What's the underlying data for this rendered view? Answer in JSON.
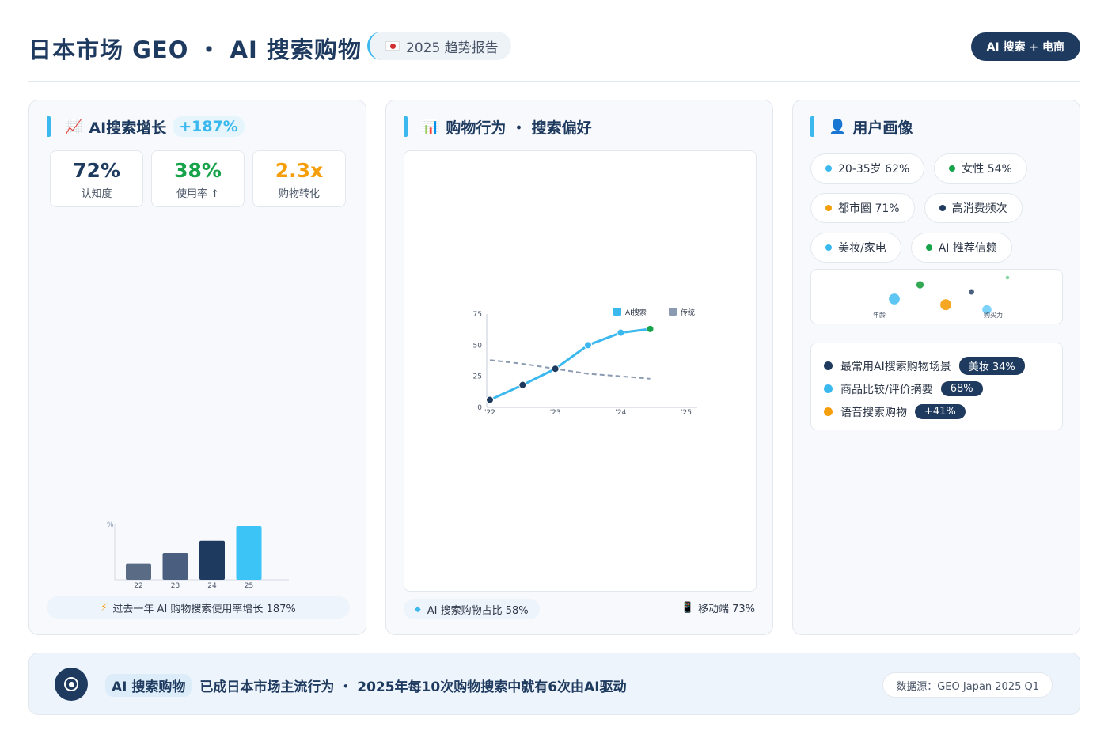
{
  "header": {
    "title": "日本市场 GEO ・ AI 搜索购物",
    "report_label": "2025 趋势报告",
    "badge": "AI 搜索 + 电商"
  },
  "panel_growth": {
    "title": "AI搜索增长",
    "icon": "chart-up-icon",
    "growth": "+187%",
    "kpis": [
      {
        "value": "72%",
        "label": "认知度",
        "color": "#1e3a5f"
      },
      {
        "value": "38%",
        "label": "使用率 ↑",
        "color": "#16a34a"
      },
      {
        "value": "2.3x",
        "label": "购物转化",
        "color": "#f59e0b"
      }
    ],
    "note": "过去一年 AI 购物搜索使用率增长 187%"
  },
  "panel_behavior": {
    "title": "购物行为 ・ 搜索偏好",
    "icon": "bar-chart-icon",
    "note_left": "AI 搜索购物占比 58%",
    "note_right": "移动端 73%"
  },
  "panel_profile": {
    "title": "用户画像",
    "icon": "user-icon",
    "tags": [
      {
        "label": "20-35岁 62%",
        "color": "#3bb8ee"
      },
      {
        "label": "女性 54%",
        "color": "#16a34a"
      },
      {
        "label": "都市圈 71%",
        "color": "#f59e0b"
      },
      {
        "label": "高消费频次",
        "color": "#1e3a5f"
      },
      {
        "label": "美妆/家电",
        "color": "#3bb8ee"
      },
      {
        "label": "AI 推荐信赖",
        "color": "#16a34a"
      }
    ],
    "scatter_labels": [
      "年龄",
      "购买力"
    ],
    "insights": [
      {
        "label": "最常用AI搜索购物场景",
        "value": "美妆 34%",
        "color": "#1e3a5f"
      },
      {
        "label": "商品比较/评价摘要",
        "value": "68%",
        "color": "#3bb8ee"
      },
      {
        "label": "语音搜索购物",
        "value": "+41%",
        "color": "#f59e0b"
      }
    ]
  },
  "footer": {
    "highlight": "AI 搜索购物",
    "text": "已成日本市场主流行为 ・ 2025年每10次购物搜索中就有6次由AI驱动",
    "source": "数据源：GEO Japan 2025 Q1"
  },
  "chart_data": [
    {
      "type": "bar",
      "categories": [
        "22",
        "23",
        "24",
        "25"
      ],
      "values": [
        12,
        20,
        29,
        40
      ],
      "ylabel": "%",
      "colors": [
        "#5a6b85",
        "#4a5f80",
        "#1e3a5f",
        "#3bc4f5"
      ]
    },
    {
      "type": "line",
      "x": [
        "'22",
        "'23",
        "'24",
        "'25"
      ],
      "x_numeric": [
        0,
        1,
        2,
        3
      ],
      "ylim": [
        0,
        75
      ],
      "yticks": [
        0,
        25,
        50,
        75
      ],
      "legend": "top-right",
      "series": [
        {
          "name": "AI搜索",
          "color": "#3bb8ee",
          "x": [
            0,
            0.5,
            1,
            1.5,
            2,
            2.45
          ],
          "y": [
            6,
            18,
            31,
            50,
            60,
            63
          ]
        },
        {
          "name": "传统",
          "color": "#8a9ab0",
          "dashed": true,
          "x": [
            0,
            0.5,
            1,
            1.5,
            2,
            2.45
          ],
          "y": [
            38,
            35,
            31,
            27,
            25,
            23
          ]
        }
      ]
    },
    {
      "type": "scatter",
      "xlabel": "年龄",
      "ylabel": "购买力",
      "points": [
        {
          "x": 1.0,
          "y": 2.0,
          "color": "#5ec6f2",
          "size": 3
        },
        {
          "x": 1.5,
          "y": 4.0,
          "color": "#34a853",
          "size": 2
        },
        {
          "x": 2.0,
          "y": 1.2,
          "color": "#f5a623",
          "size": 3
        },
        {
          "x": 2.5,
          "y": 3.0,
          "color": "#4a5f80",
          "size": 1.5
        },
        {
          "x": 2.8,
          "y": 0.5,
          "color": "#7dd3fc",
          "size": 2.5
        },
        {
          "x": 3.2,
          "y": 5.0,
          "color": "#86d4a0",
          "size": 1
        }
      ]
    }
  ]
}
